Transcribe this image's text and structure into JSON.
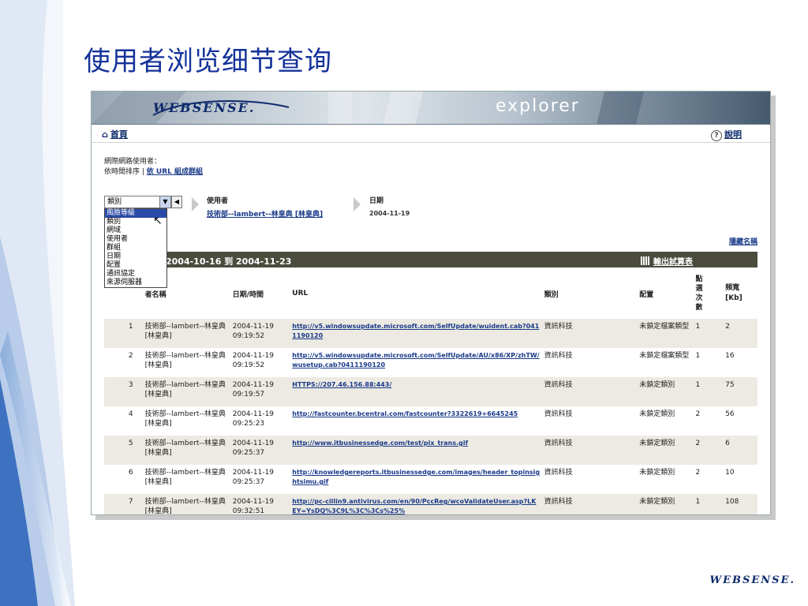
{
  "slide": {
    "title": "使用者浏览细节查询",
    "footer_logo": "WEBSENSE."
  },
  "banner": {
    "logo": "WEBSENSE.",
    "product": "explorer"
  },
  "topnav": {
    "home_label": "首頁",
    "help_label": "說明",
    "help_icon": "?"
  },
  "filters": {
    "line1": "網際網路使用者：",
    "line2_prefix": "依時間排序 | ",
    "line2_link": "依 URL 組成群組"
  },
  "select": {
    "current": "類別",
    "options": [
      "風險等級",
      "類別",
      "網域",
      "使用者",
      "群組",
      "日期",
      "配置",
      "通訊協定",
      "來源伺服器"
    ],
    "highlighted": "風險等級"
  },
  "breadcrumb": {
    "user_header": "使用者",
    "user_value": "技術部--lambert--林皇典 [林皇典]",
    "date_header": "日期",
    "date_value": "2004-11-19"
  },
  "report": {
    "hide_names": "隱藏名稱",
    "date_range": "2004-10-16 到 2004-11-23",
    "export": "輸出試算表"
  },
  "table": {
    "columns": {
      "name": "者名稱",
      "datetime": "日期/時間",
      "url": "URL",
      "category": "類別",
      "disposition": "配置",
      "hits": "點選次數",
      "bandwidth": "頻寬[Kb]"
    },
    "rows": [
      {
        "no": "1",
        "name": "技術部--lambert--林皇典 [林皇典]",
        "date": "2004-11-19",
        "time": "09:19:52",
        "url": "http://v5.windowsupdate.microsoft.com/SelfUpdate/wuident.cab?0411190120",
        "category": "資訊科技",
        "disposition": "未鎖定檔案類型",
        "hits": "1",
        "bw": "2"
      },
      {
        "no": "2",
        "name": "技術部--lambert--林皇典 [林皇典]",
        "date": "2004-11-19",
        "time": "09:19:52",
        "url": "http://v5.windowsupdate.microsoft.com/SelfUpdate/AU/x86/XP/zhTW/wusetup.cab?0411190120",
        "category": "資訊科技",
        "disposition": "未鎖定檔案類型",
        "hits": "1",
        "bw": "16"
      },
      {
        "no": "3",
        "name": "技術部--lambert--林皇典 [林皇典]",
        "date": "2004-11-19",
        "time": "09:19:57",
        "url": "HTTPS://207.46.156.88:443/",
        "category": "資訊科技",
        "disposition": "未鎖定類別",
        "hits": "1",
        "bw": "75"
      },
      {
        "no": "4",
        "name": "技術部--lambert--林皇典 [林皇典]",
        "date": "2004-11-19",
        "time": "09:25:23",
        "url": "http://fastcounter.bcentral.com/fastcounter?3322619+6645245",
        "category": "資訊科技",
        "disposition": "未鎖定類別",
        "hits": "2",
        "bw": "56"
      },
      {
        "no": "5",
        "name": "技術部--lambert--林皇典 [林皇典]",
        "date": "2004-11-19",
        "time": "09:25:37",
        "url": "http://www.itbusinessedge.com/test/pix_trans.gif",
        "category": "資訊科技",
        "disposition": "未鎖定類別",
        "hits": "2",
        "bw": "6"
      },
      {
        "no": "6",
        "name": "技術部--lambert--林皇典 [林皇典]",
        "date": "2004-11-19",
        "time": "09:25:37",
        "url": "http://knowledgereports.itbusinessedge.com/images/header_topinsightsimu.gif",
        "category": "資訊科技",
        "disposition": "未鎖定類別",
        "hits": "2",
        "bw": "10"
      },
      {
        "no": "7",
        "name": "技術部--lambert--林皇典 [林皇典]",
        "date": "2004-11-19",
        "time": "09:32:51",
        "url": "http://pc-cillin9.antivirus.com/en/90/PccReg/wcoValidateUser.asp?LKEY=YsDQ%3C9L%3C%3Cs%25%",
        "category": "資訊科技",
        "disposition": "未鎖定類別",
        "hits": "1",
        "bw": "108"
      }
    ]
  },
  "colors": {
    "title": "#14329a",
    "link": "#1a3a8a",
    "header_bar": "#4b4c3e",
    "row_alt": "#eceae2"
  }
}
